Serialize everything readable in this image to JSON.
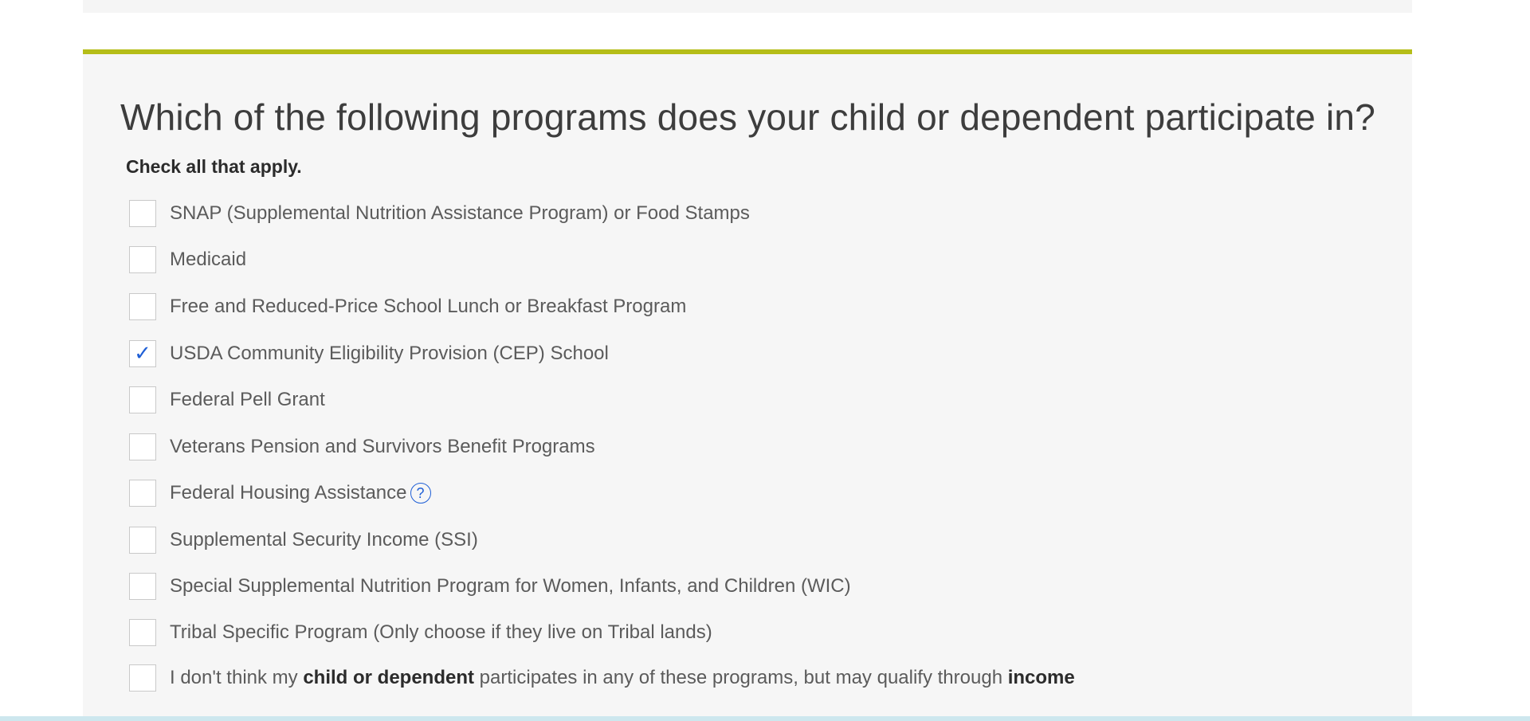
{
  "question": {
    "title": "Which of the following programs does your child or dependent participate in?",
    "hint": "Check all that apply."
  },
  "options": [
    {
      "label": "SNAP (Supplemental Nutrition Assistance Program) or Food Stamps",
      "checked": false
    },
    {
      "label": "Medicaid",
      "checked": false
    },
    {
      "label": "Free and Reduced-Price School Lunch or Breakfast Program",
      "checked": false
    },
    {
      "label": "USDA Community Eligibility Provision (CEP) School",
      "checked": true
    },
    {
      "label": "Federal Pell Grant",
      "checked": false
    },
    {
      "label": "Veterans Pension and Survivors Benefit Programs",
      "checked": false
    },
    {
      "label": "Federal Housing Assistance",
      "checked": false,
      "help_icon": "question-circle-icon",
      "help_glyph": "?"
    },
    {
      "label": "Supplemental Security Income (SSI)",
      "checked": false
    },
    {
      "label": "Special Supplemental Nutrition Program for Women, Infants, and Children (WIC)",
      "checked": false
    },
    {
      "label": "Tribal Specific Program (Only choose if they live on Tribal lands)",
      "checked": false
    },
    {
      "checked": false,
      "label_parts": {
        "p1": "I don't think my ",
        "b1": "child or dependent",
        "p2": " participates in any of these programs, but may qualify through ",
        "b2": "income"
      }
    }
  ],
  "check_glyph": "✓",
  "colors": {
    "accent_bar": "#b5bd18",
    "check": "#1f5fd6",
    "card_bg": "#f6f6f6"
  }
}
